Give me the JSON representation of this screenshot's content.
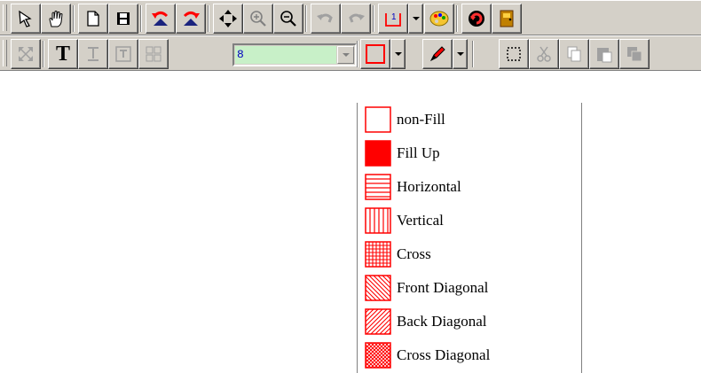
{
  "toolbar_top": {
    "buttons": [
      {
        "name": "select-arrow-icon"
      },
      {
        "name": "hand-pan-icon"
      },
      {
        "name": "new-page-icon"
      },
      {
        "name": "save-disk-icon"
      },
      {
        "name": "rotate-left-icon"
      },
      {
        "name": "rotate-right-icon"
      },
      {
        "name": "move-cross-icon"
      },
      {
        "name": "zoom-in-icon"
      },
      {
        "name": "zoom-out-icon"
      },
      {
        "name": "undo-icon"
      },
      {
        "name": "redo-icon"
      },
      {
        "name": "page-number-icon"
      },
      {
        "name": "palette-icon"
      },
      {
        "name": "refresh-icon"
      },
      {
        "name": "exit-door-icon"
      }
    ],
    "page_icon_text": "1"
  },
  "toolbar_bottom": {
    "line_width_value": "8",
    "text_tool_label": "T"
  },
  "fill_menu": {
    "items": [
      {
        "label": "non-Fill",
        "pattern": "none"
      },
      {
        "label": "Fill Up",
        "pattern": "solid"
      },
      {
        "label": "Horizontal",
        "pattern": "horizontal"
      },
      {
        "label": "Vertical",
        "pattern": "vertical"
      },
      {
        "label": "Cross",
        "pattern": "cross"
      },
      {
        "label": "Front Diagonal",
        "pattern": "front-diagonal"
      },
      {
        "label": "Back Diagonal",
        "pattern": "back-diagonal"
      },
      {
        "label": "Cross Diagonal",
        "pattern": "cross-diagonal"
      }
    ]
  },
  "colors": {
    "accent_red": "#ff0000",
    "toolbar_bg": "#d4d0c8",
    "combo_bg": "#c8f0c8"
  }
}
